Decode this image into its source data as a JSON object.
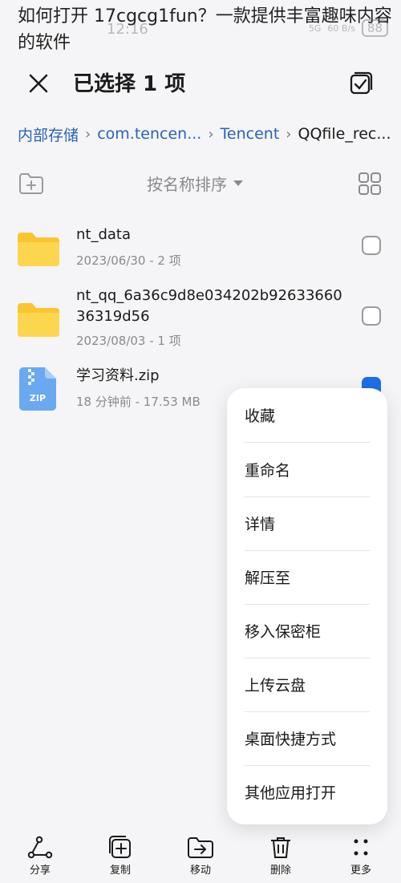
{
  "overlay_title": "如何打开 17cgcg1fun？一款提供丰富趣味内容的软件",
  "status": {
    "time": "12:16",
    "network": "5G",
    "speed": "60 B/s",
    "battery": "88"
  },
  "header": {
    "title": "已选择 1 项"
  },
  "breadcrumb": [
    "内部存储",
    "com.tencen...",
    "Tencent",
    "QQfile_rec..."
  ],
  "sort": {
    "label": "按名称排序"
  },
  "files": [
    {
      "name": "nt_data",
      "meta": "2023/06/30 - 2 项",
      "type": "folder",
      "checked": false
    },
    {
      "name": "nt_qq_6a36c9d8e034202b92633660\n36319d56",
      "meta": "2023/08/03 - 1 项",
      "type": "folder",
      "checked": false
    },
    {
      "name": "学习资料.zip",
      "meta": "18 分钟前 - 17.53 MB",
      "type": "zip",
      "icon_text": "ZIP",
      "checked": true
    }
  ],
  "context_menu": [
    "收藏",
    "重命名",
    "详情",
    "解压至",
    "移入保密柜",
    "上传云盘",
    "桌面快捷方式",
    "其他应用打开"
  ],
  "bottom_bar": [
    "分享",
    "复制",
    "移动",
    "删除",
    "更多"
  ],
  "colors": {
    "accent": "#1e6ee6",
    "breadcrumb": "#2a62b8",
    "folder": "#fcd34d",
    "zip": "#6aa9ef"
  }
}
